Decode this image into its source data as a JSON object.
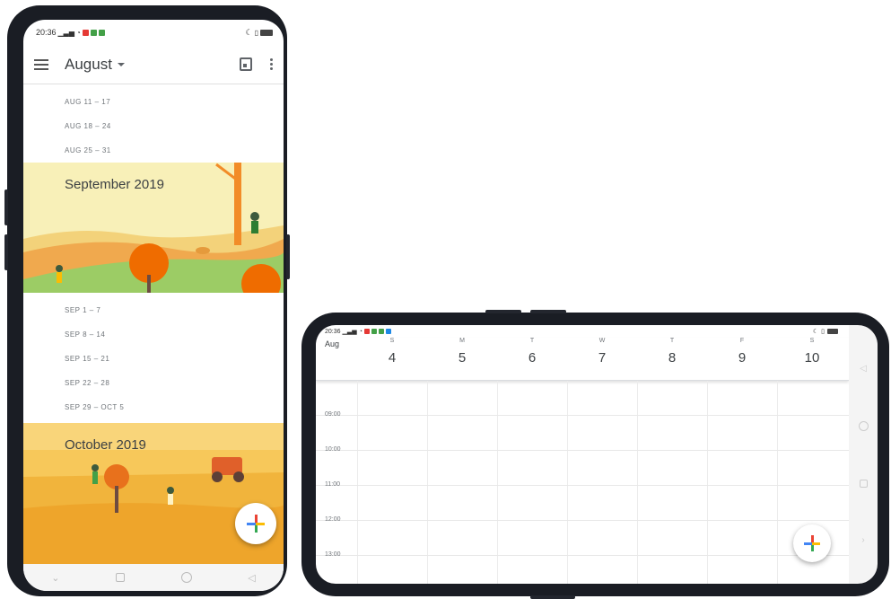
{
  "portrait": {
    "status_time": "20:36",
    "header_month": "August",
    "august_weeks": [
      "AUG 11 – 17",
      "AUG 18 – 24",
      "AUG 25 – 31"
    ],
    "september_title": "September 2019",
    "september_weeks": [
      "SEP 1 – 7",
      "SEP 8 – 14",
      "SEP 15 – 21",
      "SEP 22 – 28",
      "SEP 29 – OCT 5"
    ],
    "october_title": "October 2019",
    "icons": [
      "menu-icon",
      "dropdown-caret-icon",
      "calendar-today-icon",
      "more-vert-icon",
      "add-icon"
    ]
  },
  "landscape": {
    "status_time": "20:36",
    "month_label": "Aug",
    "days": [
      {
        "letter": "S",
        "num": "4"
      },
      {
        "letter": "M",
        "num": "5"
      },
      {
        "letter": "T",
        "num": "6"
      },
      {
        "letter": "W",
        "num": "7"
      },
      {
        "letter": "T",
        "num": "8"
      },
      {
        "letter": "F",
        "num": "9"
      },
      {
        "letter": "S",
        "num": "10"
      }
    ],
    "hours": [
      "09:00",
      "10:00",
      "11:00",
      "12:00",
      "13:00"
    ]
  },
  "colors": {
    "google_blue": "#4285f4",
    "google_red": "#ea4335",
    "google_yellow": "#fbbc04",
    "google_green": "#34a853",
    "september_banner": "#f7efb4",
    "october_banner": "#f5c349"
  }
}
